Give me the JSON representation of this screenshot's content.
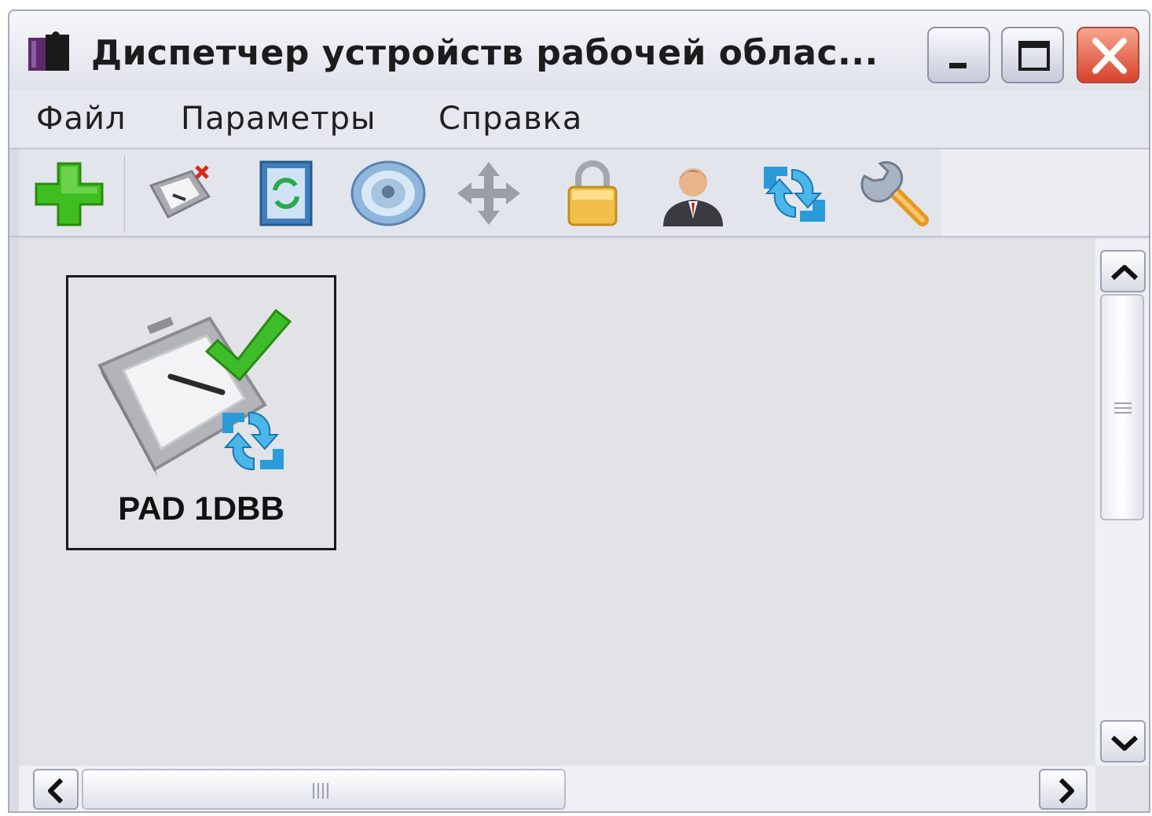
{
  "window": {
    "title": "Диспетчер устройств рабочей облас...",
    "app_icon": "app-icon",
    "controls": {
      "minimize_icon": "minimize-icon",
      "maximize_icon": "maximize-icon",
      "close_icon": "close-icon"
    }
  },
  "menubar": {
    "items": [
      {
        "label": "Файл"
      },
      {
        "label": "Параметры"
      },
      {
        "label": "Справка"
      }
    ]
  },
  "toolbar": {
    "tools": [
      {
        "icon": "add-icon"
      },
      {
        "icon": "remove-device-icon"
      },
      {
        "icon": "refresh-device-icon"
      },
      {
        "icon": "speaker-icon"
      },
      {
        "icon": "move-icon"
      },
      {
        "icon": "lock-icon"
      },
      {
        "icon": "user-icon"
      },
      {
        "icon": "sync-icon"
      },
      {
        "icon": "settings-wrench-icon"
      }
    ]
  },
  "devices": [
    {
      "label": "PAD 1DBB",
      "icon": "tablet-device-icon",
      "status_icon": "checkmark-icon",
      "sync_icon": "sync-icon"
    }
  ],
  "colors": {
    "window_bg": "#d8dbe3",
    "content_bg": "#e2e3e7",
    "close_button": "#d8432d",
    "accent_green": "#3fbf1f",
    "accent_blue": "#2a9ad8"
  }
}
